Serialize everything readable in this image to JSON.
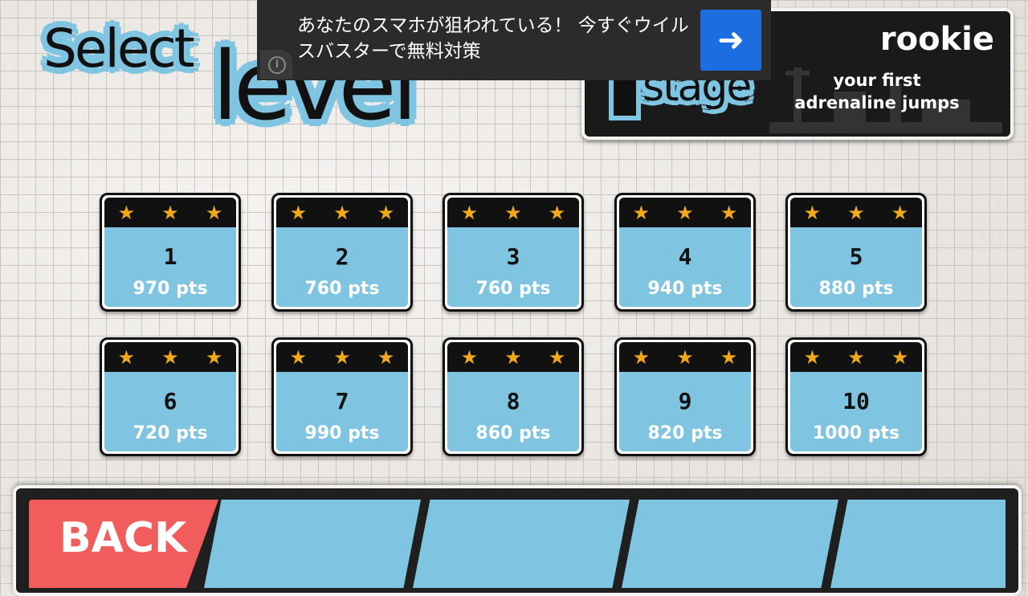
{
  "title": {
    "select": "Select",
    "level": "level"
  },
  "stage": {
    "number": "1",
    "word": "stage",
    "rank": "rookie",
    "description_line1": "your first",
    "description_line2": "adrenaline jumps"
  },
  "ad": {
    "text": "あなたのスマホが狙われている！ 今すぐウイルスバスターで無料対策",
    "info_icon": "info-icon",
    "arrow_icon": "arrow-right-icon"
  },
  "levels": [
    {
      "number": "1",
      "points": "970 pts",
      "stars": 3
    },
    {
      "number": "2",
      "points": "760 pts",
      "stars": 3
    },
    {
      "number": "3",
      "points": "760 pts",
      "stars": 3
    },
    {
      "number": "4",
      "points": "940 pts",
      "stars": 3
    },
    {
      "number": "5",
      "points": "880 pts",
      "stars": 3
    },
    {
      "number": "6",
      "points": "720 pts",
      "stars": 3
    },
    {
      "number": "7",
      "points": "990 pts",
      "stars": 3
    },
    {
      "number": "8",
      "points": "860 pts",
      "stars": 3
    },
    {
      "number": "9",
      "points": "820 pts",
      "stars": 3
    },
    {
      "number": "10",
      "points": "1000 pts",
      "stars": 3
    }
  ],
  "bottom": {
    "back_label": "BACK"
  },
  "colors": {
    "accent_blue": "#7fc4e0",
    "star": "#f2a81d",
    "back_red": "#f15d5d",
    "ad_button": "#1c6ee0"
  }
}
